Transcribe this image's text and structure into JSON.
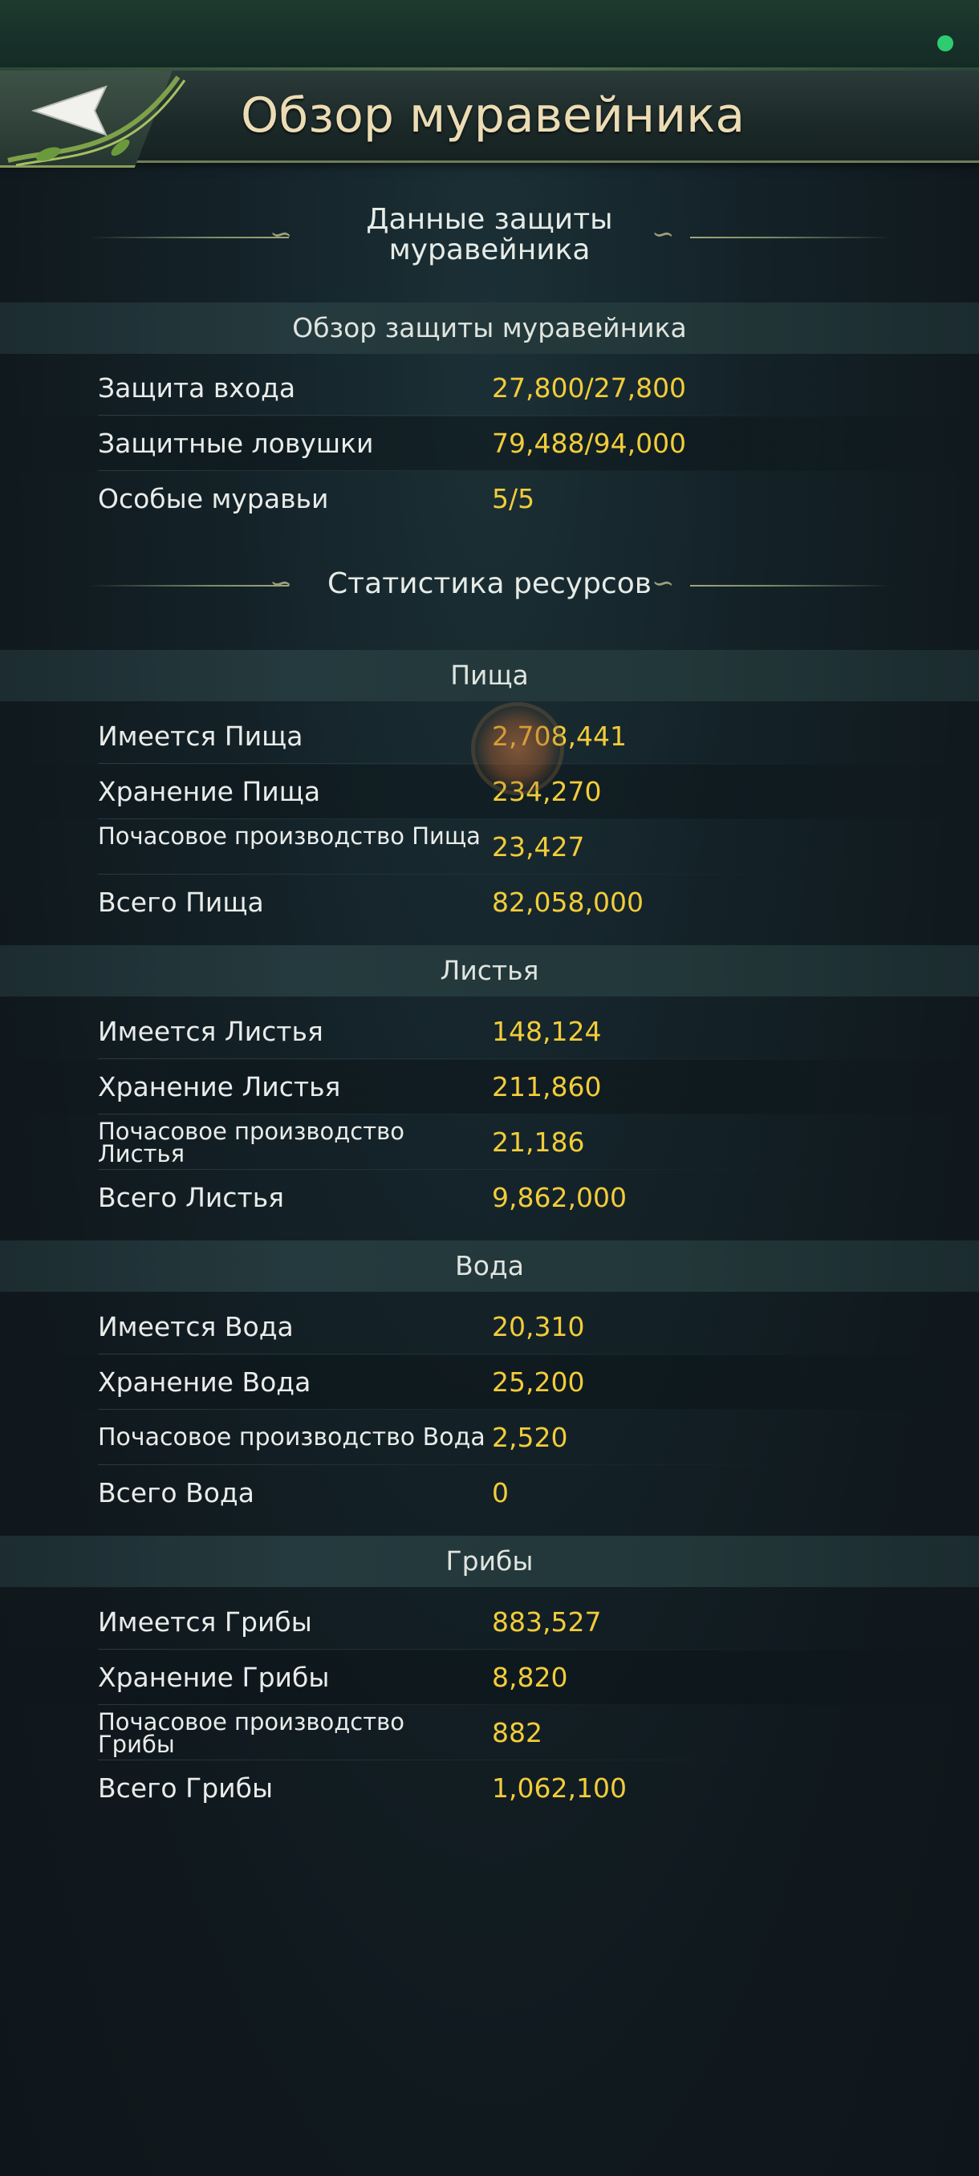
{
  "header": {
    "title": "Обзор муравейника",
    "back_icon": "back-arrow-icon"
  },
  "defense": {
    "section_title_line1": "Данные защиты",
    "section_title_line2": "муравейника",
    "band_title": "Обзор защиты муравейника",
    "rows": [
      {
        "label": "Защита входа",
        "value": "27,800/27,800"
      },
      {
        "label": "Защитные ловушки",
        "value": "79,488/94,000"
      },
      {
        "label": "Особые муравьи",
        "value": "5/5"
      }
    ]
  },
  "resources": {
    "section_title": "Статистика ресурсов",
    "food": {
      "band_title": "Пища",
      "rows": [
        {
          "label": "Имеется Пища",
          "value": "2,708,441"
        },
        {
          "label": "Хранение Пища",
          "value": "234,270"
        },
        {
          "label": "Почасовое производство Пища",
          "value": "23,427"
        },
        {
          "label": "Всего Пища",
          "value": "82,058,000"
        }
      ]
    },
    "leaves": {
      "band_title": "Листья",
      "rows": [
        {
          "label": "Имеется Листья",
          "value": "148,124"
        },
        {
          "label": "Хранение Листья",
          "value": "211,860"
        },
        {
          "label": "Почасовое производство Листья",
          "value": "21,186"
        },
        {
          "label": "Всего Листья",
          "value": "9,862,000"
        }
      ]
    },
    "water": {
      "band_title": "Вода",
      "rows": [
        {
          "label": "Имеется Вода",
          "value": "20,310"
        },
        {
          "label": "Хранение Вода",
          "value": "25,200"
        },
        {
          "label": "Почасовое производство Вода",
          "value": "2,520"
        },
        {
          "label": "Всего Вода",
          "value": "0"
        }
      ]
    },
    "fungi": {
      "band_title": "Грибы",
      "rows": [
        {
          "label": "Имеется Грибы",
          "value": "883,527"
        },
        {
          "label": "Хранение Грибы",
          "value": "8,820"
        },
        {
          "label": "Почасовое производство Грибы",
          "value": "882"
        },
        {
          "label": "Всего Грибы",
          "value": "1,062,100"
        }
      ]
    }
  },
  "colors": {
    "value": "#f2cc3a",
    "label": "#e9ecea",
    "title": "#ecdcb4",
    "status_dot": "#2ecc71"
  }
}
